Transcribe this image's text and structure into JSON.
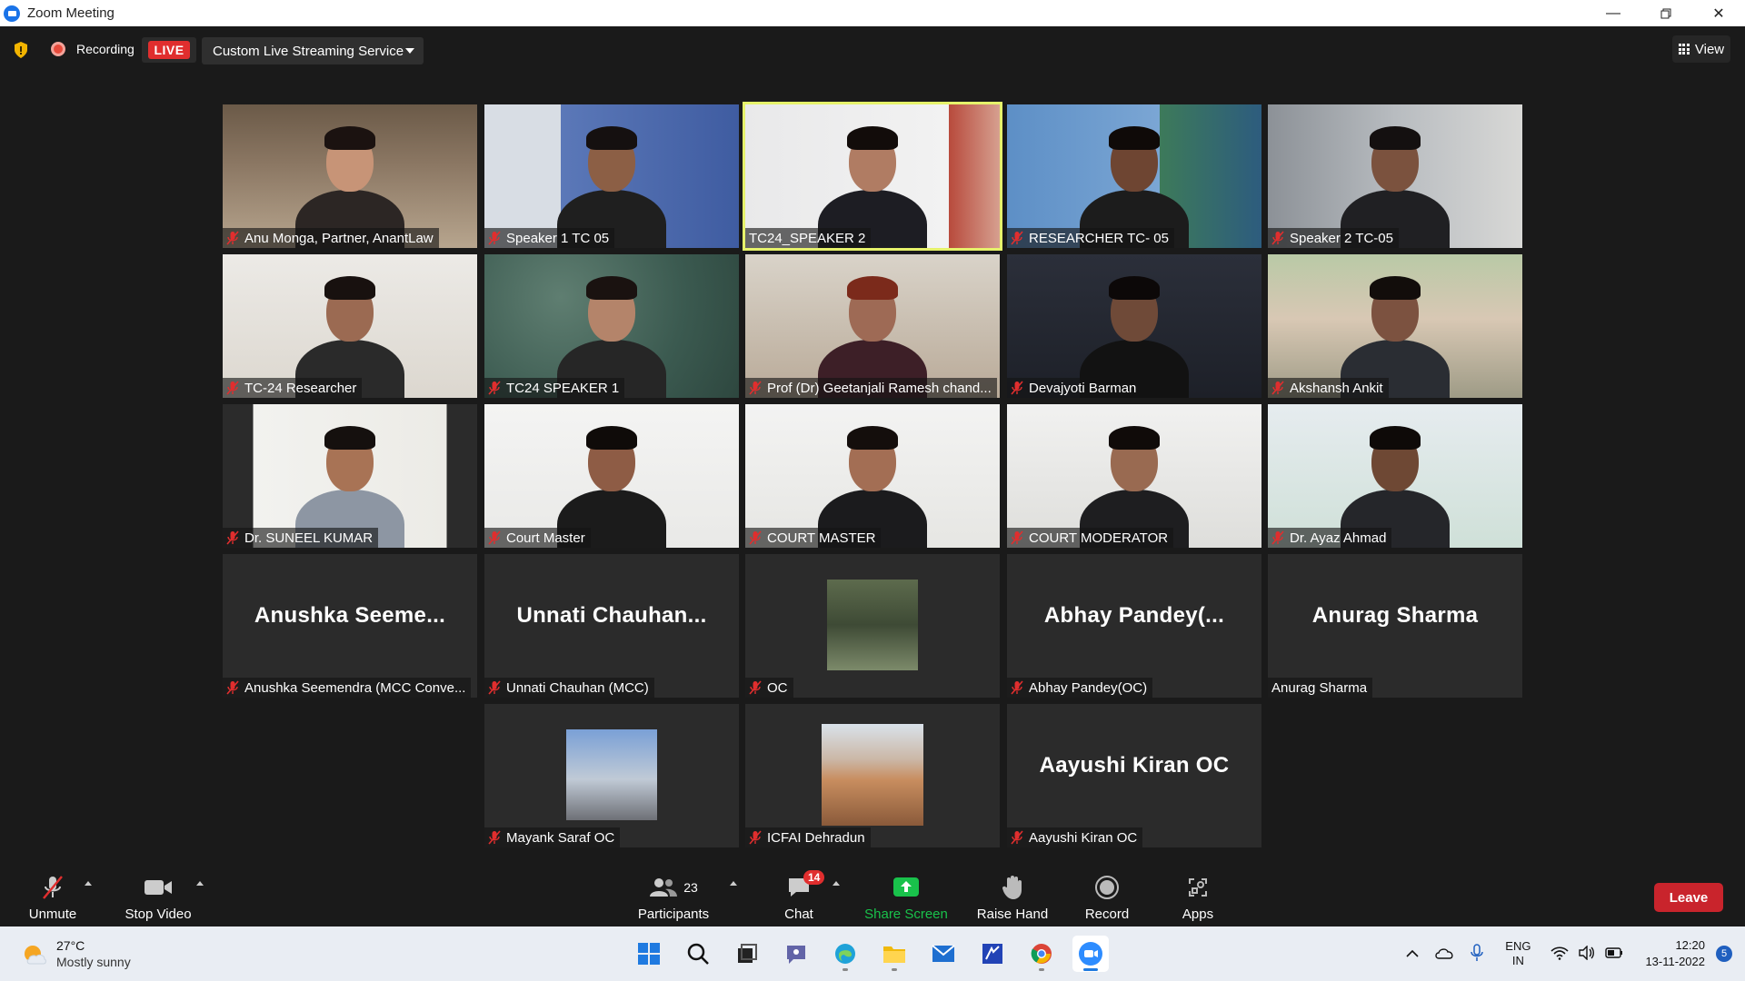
{
  "window": {
    "title": "Zoom Meeting"
  },
  "status": {
    "recording_label": "Recording",
    "live_label": "LIVE",
    "stream_service": "Custom Live Streaming Service",
    "view_label": "View"
  },
  "participants_tiles": [
    {
      "name": "Anu Monga, Partner, AnantLaw",
      "muted": true,
      "kind": "video"
    },
    {
      "name": "Speaker 1 TC 05",
      "muted": true,
      "kind": "video"
    },
    {
      "name": "TC24_SPEAKER 2",
      "muted": false,
      "kind": "video",
      "active_speaker": true
    },
    {
      "name": "RESEARCHER TC- 05",
      "muted": true,
      "kind": "video"
    },
    {
      "name": "Speaker 2 TC-05",
      "muted": true,
      "kind": "video"
    },
    {
      "name": "TC-24 Researcher",
      "muted": true,
      "kind": "video"
    },
    {
      "name": "TC24 SPEAKER 1",
      "muted": true,
      "kind": "video"
    },
    {
      "name": "Prof (Dr) Geetanjali Ramesh chand...",
      "muted": true,
      "kind": "video"
    },
    {
      "name": "Devajyoti Barman",
      "muted": true,
      "kind": "video"
    },
    {
      "name": "Akshansh Ankit",
      "muted": true,
      "kind": "video"
    },
    {
      "name": "Dr. SUNEEL KUMAR",
      "muted": true,
      "kind": "video"
    },
    {
      "name": "Court Master",
      "muted": true,
      "kind": "video"
    },
    {
      "name": "COURT MASTER",
      "muted": true,
      "kind": "video"
    },
    {
      "name": "COURT MODERATOR",
      "muted": true,
      "kind": "video"
    },
    {
      "name": "Dr. Ayaz Ahmad",
      "muted": true,
      "kind": "video"
    },
    {
      "name": "Anushka Seemendra (MCC Conve...",
      "muted": true,
      "kind": "name",
      "display": "Anushka  Seeme..."
    },
    {
      "name": "Unnati Chauhan (MCC)",
      "muted": true,
      "kind": "name",
      "display": "Unnati  Chauhan..."
    },
    {
      "name": "OC",
      "muted": true,
      "kind": "avatar"
    },
    {
      "name": "Abhay Pandey(OC)",
      "muted": true,
      "kind": "name",
      "display": "Abhay  Pandey(..."
    },
    {
      "name": "Anurag Sharma",
      "muted": false,
      "kind": "name",
      "display": "Anurag Sharma"
    },
    {
      "name": "Mayank Saraf OC",
      "muted": true,
      "kind": "avatar"
    },
    {
      "name": "ICFAI Dehradun",
      "muted": true,
      "kind": "avatar"
    },
    {
      "name": "Aayushi Kiran OC",
      "muted": true,
      "kind": "name",
      "display": "Aayushi Kiran OC"
    }
  ],
  "toolbar": {
    "unmute": "Unmute",
    "stop_video": "Stop Video",
    "participants": "Participants",
    "participants_count": "23",
    "chat": "Chat",
    "chat_badge": "14",
    "share_screen": "Share Screen",
    "raise_hand": "Raise Hand",
    "record": "Record",
    "apps": "Apps",
    "leave": "Leave"
  },
  "taskbar": {
    "temperature": "27°C",
    "weather": "Mostly sunny",
    "lang1": "ENG",
    "lang2": "IN",
    "time": "12:20",
    "date": "13-11-2022",
    "notif_count": "5"
  },
  "colors": {
    "accent_green": "#19c24b",
    "leave_red": "#c9242c",
    "live_red": "#e02e2e",
    "active_outline": "#e6f26b"
  }
}
